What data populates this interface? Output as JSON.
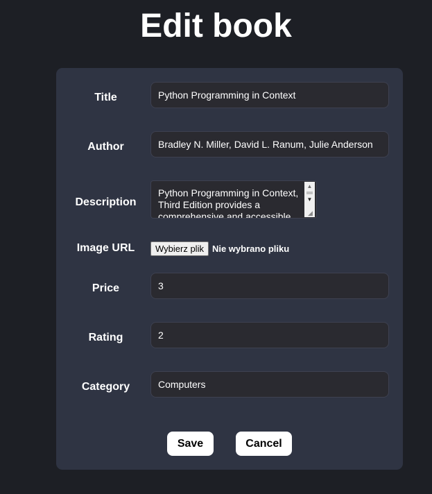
{
  "page": {
    "title": "Edit book"
  },
  "form": {
    "title": {
      "label": "Title",
      "value": "Python Programming in Context"
    },
    "author": {
      "label": "Author",
      "value": "Bradley N. Miller, David L. Ranum, Julie Anderson"
    },
    "description": {
      "label": "Description",
      "value": "Python Programming in Context, Third Edition provides a comprehensive and accessible"
    },
    "image_url": {
      "label": "Image URL",
      "button_label": "Wybierz plik",
      "status": "Nie wybrano pliku"
    },
    "price": {
      "label": "Price",
      "value": "3"
    },
    "rating": {
      "label": "Rating",
      "value": "2"
    },
    "category": {
      "label": "Category",
      "value": "Computers"
    }
  },
  "actions": {
    "save_label": "Save",
    "cancel_label": "Cancel"
  },
  "colors": {
    "background": "#1d1f25",
    "card": "#2f3443",
    "input": "#2a2a30",
    "button": "#ffffff"
  }
}
